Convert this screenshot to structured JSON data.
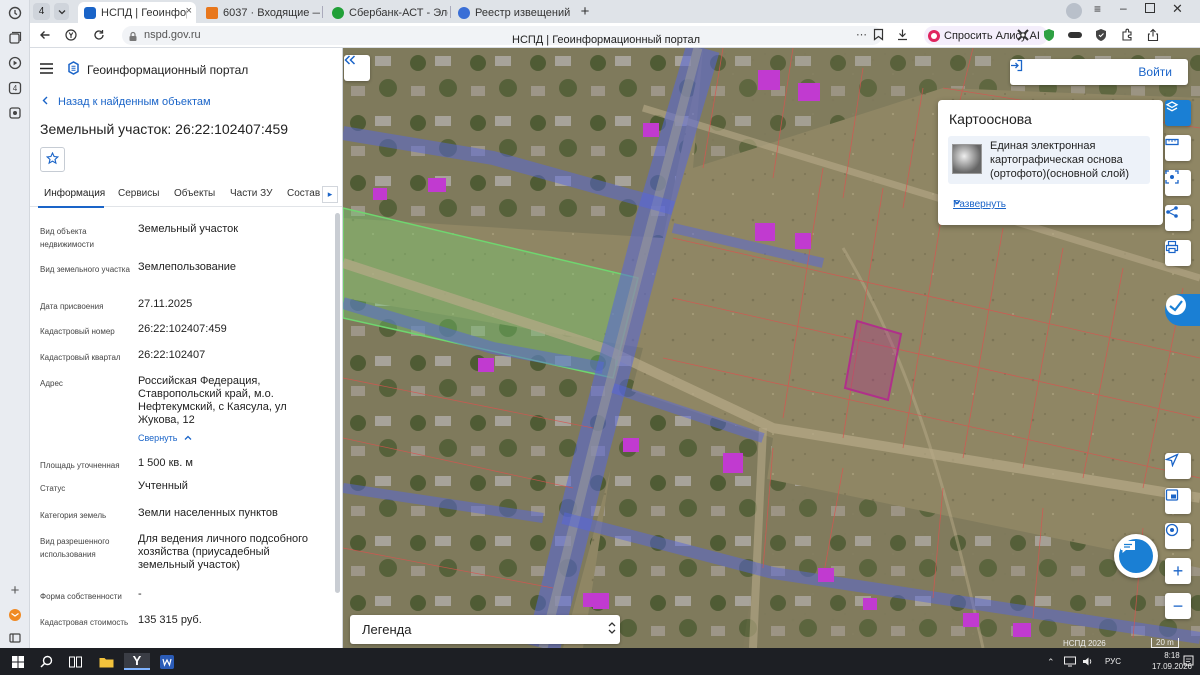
{
  "browser": {
    "tab_count": "4",
    "tabs": [
      {
        "label": "НСПД | Геоинформаци",
        "active": true,
        "favicon_color": "#1a64c8"
      },
      {
        "label": "6037 · Входящие — Яндек",
        "active": false,
        "favicon_color": "#e8771c"
      },
      {
        "label": "Сбербанк-АСТ - Электрон",
        "active": false,
        "favicon_color": "#21a038"
      },
      {
        "label": "Реестр извещений",
        "active": false,
        "favicon_color": "#3b6fd6"
      }
    ],
    "url": "nspd.gov.ru",
    "page_title": "НСПД | Геоинформационный портал",
    "alice_label": "Спросить Алису AI"
  },
  "sidebar": {
    "portal_title": "Геоинформационный портал",
    "back_label": "Назад к найденным объектам",
    "object_title": "Земельный участок: 26:22:102407:459",
    "tabs": [
      "Информация",
      "Сервисы",
      "Объекты",
      "Части ЗУ",
      "Состав"
    ],
    "fields": [
      {
        "label": "Вид объекта недвижимости",
        "value": "Земельный участок"
      },
      {
        "label": "Вид земельного участка",
        "value": "Землепользование"
      },
      {
        "label": "Дата присвоения",
        "value": "27.11.2025"
      },
      {
        "label": "Кадастровый номер",
        "value": "26:22:102407:459"
      },
      {
        "label": "Кадастровый квартал",
        "value": "26:22:102407"
      },
      {
        "label": "Адрес",
        "value": "Российская Федерация, Ставропольский край, м.о. Нефтекумский, с Каясула, ул Жукова, 12"
      },
      {
        "label": "Площадь уточненная",
        "value": "1 500 кв. м"
      },
      {
        "label": "Статус",
        "value": "Учтенный"
      },
      {
        "label": "Категория земель",
        "value": "Земли населенных пунктов"
      },
      {
        "label": "Вид разрешенного использования",
        "value": "Для ведения личного подсобного хозяйства (приусадебный земельный участок)"
      },
      {
        "label": "Форма собственности",
        "value": "-"
      },
      {
        "label": "Кадастровая стоимость",
        "value": "135 315 руб."
      }
    ],
    "collapse_label": "Свернуть"
  },
  "map": {
    "login_label": "Войти",
    "basemap_title": "Картооснова",
    "basemap_layer": "Единая электронная картографическая основа (ортофото)(основной слой)",
    "expand_label": "Развернуть",
    "legend_label": "Легенда",
    "attribution": "НСПД 2026",
    "scale_label": "20 m"
  },
  "taskbar": {
    "lang": "РУС",
    "time": "8:18",
    "date": "17.09.2026"
  },
  "colors": {
    "accent": "#1a64c8",
    "parcel_selected": "#b0308a",
    "road_overlay": "#5566dd",
    "zone_green": "#6fd66f"
  }
}
